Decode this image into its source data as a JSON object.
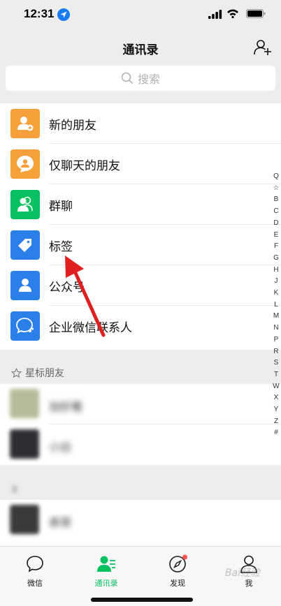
{
  "status": {
    "time": "12:31"
  },
  "nav": {
    "title": "通讯录"
  },
  "search": {
    "placeholder": "搜索"
  },
  "entries": [
    {
      "label": "新的朋友",
      "icon": "new-friend-icon",
      "color": "#f5a03a"
    },
    {
      "label": "仅聊天的朋友",
      "icon": "chat-only-icon",
      "color": "#f5a03a"
    },
    {
      "label": "群聊",
      "icon": "group-chat-icon",
      "color": "#07c160"
    },
    {
      "label": "标签",
      "icon": "tag-icon",
      "color": "#2b7fe8"
    },
    {
      "label": "公众号",
      "icon": "official-account-icon",
      "color": "#2b7fe8"
    },
    {
      "label": "企业微信联系人",
      "icon": "wecom-icon",
      "color": "#2b7fe8"
    }
  ],
  "starred": {
    "header": "星标朋友"
  },
  "contacts": [
    {
      "name": "加好看"
    },
    {
      "name": "小白"
    }
  ],
  "section2": {
    "header": "X",
    "contacts": [
      {
        "name": "表哥"
      }
    ]
  },
  "index_letters": [
    "Q",
    "☆",
    "B",
    "C",
    "D",
    "E",
    "F",
    "G",
    "H",
    "J",
    "K",
    "L",
    "M",
    "N",
    "P",
    "R",
    "S",
    "T",
    "W",
    "X",
    "Y",
    "Z",
    "#"
  ],
  "tabs": [
    {
      "label": "微信",
      "icon": "chat-bubble-icon",
      "active": false
    },
    {
      "label": "通讯录",
      "icon": "contacts-icon",
      "active": true
    },
    {
      "label": "发现",
      "icon": "compass-icon",
      "active": false
    },
    {
      "label": "我",
      "icon": "person-icon",
      "active": false
    }
  ],
  "watermark": "Bai经验",
  "colors": {
    "accent": "#07c160",
    "arrow": "#e02020"
  }
}
